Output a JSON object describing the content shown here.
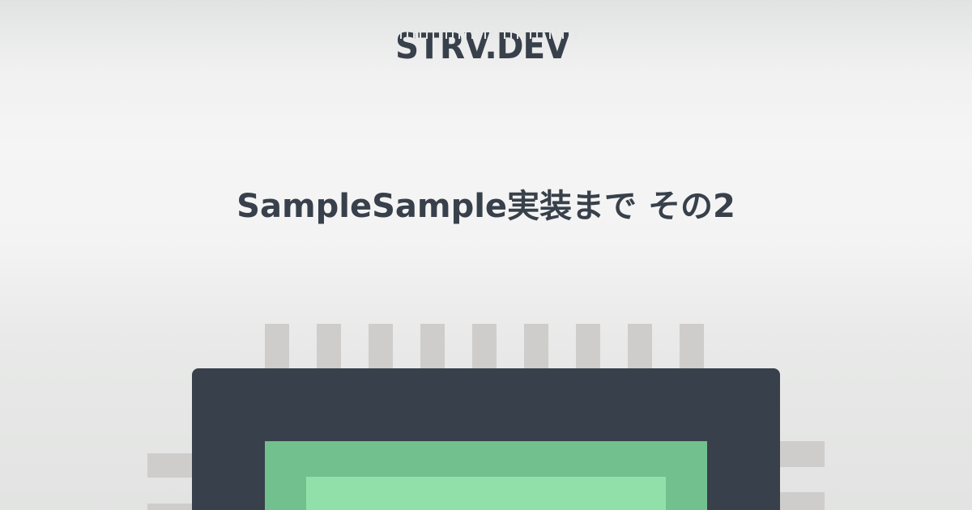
{
  "header": {
    "logo_text": "STRV.DEV"
  },
  "hero": {
    "title": "SampleSample実装まで その2"
  },
  "illustration": {
    "icon": "microchip-icon",
    "colors": {
      "chip_body": "#38404b",
      "chip_frame": "#73c08f",
      "chip_core": "#92e0a9",
      "pins": "#cfcdcb"
    }
  }
}
